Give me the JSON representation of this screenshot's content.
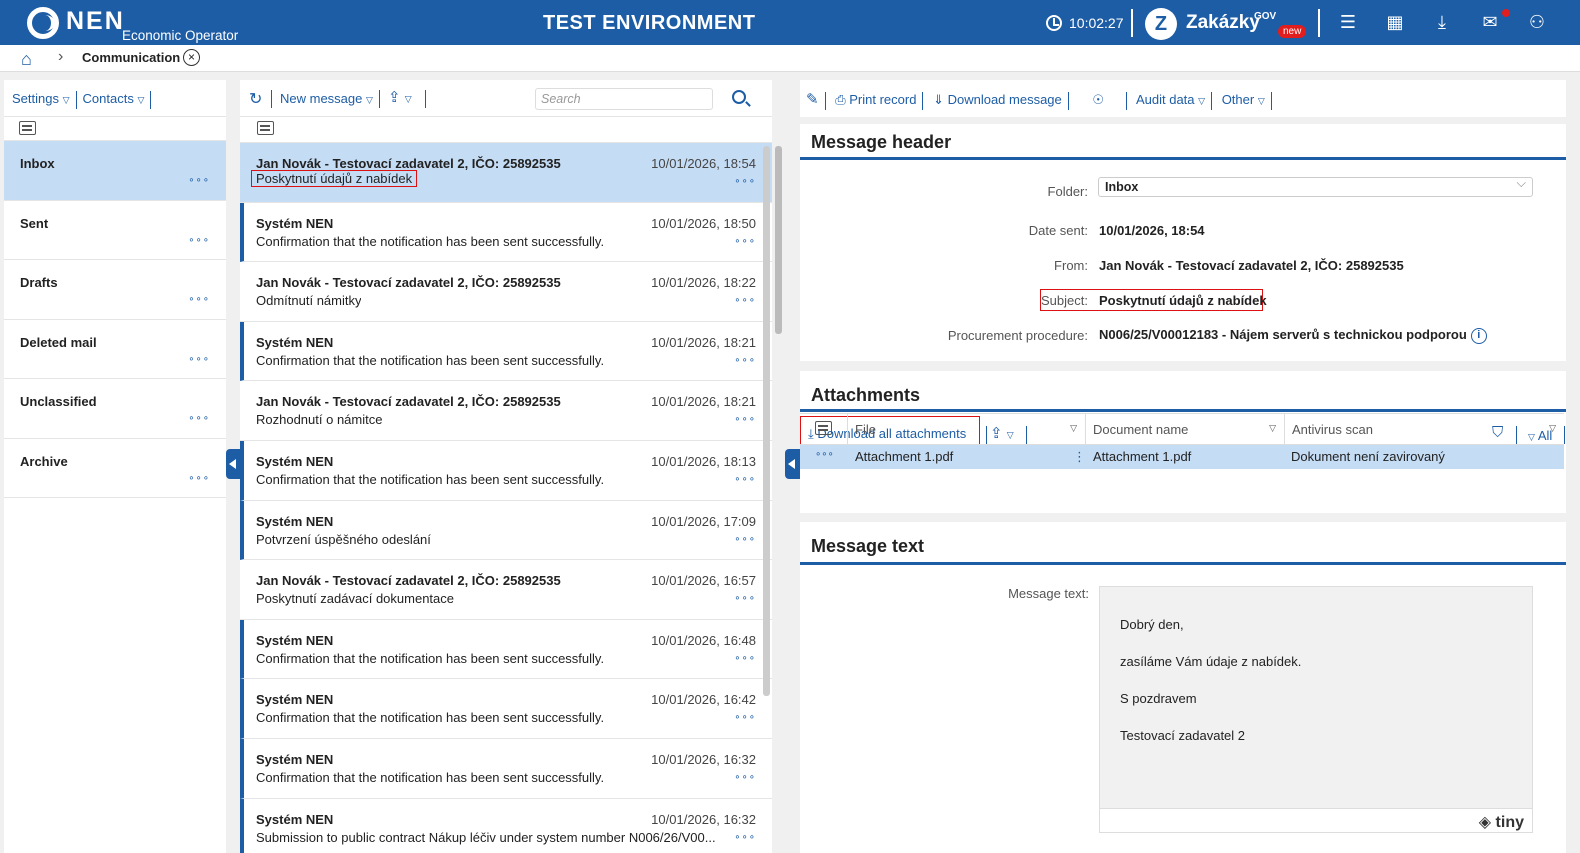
{
  "header": {
    "logo": "NEN",
    "logo_sub": "Economic Operator",
    "environment": "TEST ENVIRONMENT",
    "time": "10:02:27",
    "zakazky": "Zakázky",
    "zakazky_sup": "GOV",
    "zakazky_badge": "new",
    "colors": {
      "primary": "#1d5da6",
      "badge": "#e11d1d"
    }
  },
  "breadcrumb": {
    "title": "Communication"
  },
  "folders": {
    "toolbar": {
      "settings": "Settings",
      "contacts": "Contacts"
    },
    "items": [
      "Inbox",
      "Sent",
      "Drafts",
      "Deleted mail",
      "Unclassified",
      "Archive"
    ],
    "active_index": 0
  },
  "messages": {
    "toolbar": {
      "new_message": "New message",
      "search_placeholder": "Search"
    },
    "items": [
      {
        "from": "Jan Novák - Testovací zadavatel 2, IČO: 25892535",
        "subject": "Poskytnutí údajů z nabídek",
        "date": "10/01/2026, 18:54"
      },
      {
        "from": "Systém NEN",
        "subject": "Confirmation that the notification has been sent successfully.",
        "date": "10/01/2026, 18:50"
      },
      {
        "from": "Jan Novák - Testovací zadavatel 2, IČO: 25892535",
        "subject": "Odmítnutí námitky",
        "date": "10/01/2026, 18:22"
      },
      {
        "from": "Systém NEN",
        "subject": "Confirmation that the notification has been sent successfully.",
        "date": "10/01/2026, 18:21"
      },
      {
        "from": "Jan Novák - Testovací zadavatel 2, IČO: 25892535",
        "subject": "Rozhodnutí o námitce",
        "date": "10/01/2026, 18:21"
      },
      {
        "from": "Systém NEN",
        "subject": "Confirmation that the notification has been sent successfully.",
        "date": "10/01/2026, 18:13"
      },
      {
        "from": "Systém NEN",
        "subject": "Potvrzení úspěšného odeslání",
        "date": "10/01/2026, 17:09"
      },
      {
        "from": "Jan Novák - Testovací zadavatel 2, IČO: 25892535",
        "subject": "Poskytnutí zadávací dokumentace",
        "date": "10/01/2026, 16:57"
      },
      {
        "from": "Systém NEN",
        "subject": "Confirmation that the notification has been sent successfully.",
        "date": "10/01/2026, 16:48"
      },
      {
        "from": "Systém NEN",
        "subject": "Confirmation that the notification has been sent successfully.",
        "date": "10/01/2026, 16:42"
      },
      {
        "from": "Systém NEN",
        "subject": "Confirmation that the notification has been sent successfully.",
        "date": "10/01/2026, 16:32"
      },
      {
        "from": "Systém NEN",
        "subject": "Submission to public contract Nákup léčiv under system number N006/26/V00...",
        "date": "10/01/2026, 16:32"
      }
    ]
  },
  "detail": {
    "toolbar": {
      "print": "Print record",
      "download": "Download message",
      "audit": "Audit data",
      "other": "Other"
    },
    "header_title": "Message header",
    "fields": {
      "folder_label": "Folder:",
      "folder_value": "Inbox",
      "date_label": "Date sent:",
      "date_value": "10/01/2026, 18:54",
      "from_label": "From:",
      "from_value": "Jan Novák - Testovací zadavatel 2, IČO: 25892535",
      "subject_label": "Subject:",
      "subject_value": "Poskytnutí údajů z nabídek",
      "procedure_label": "Procurement procedure:",
      "procedure_value": "N006/25/V00012183 - Nájem serverů s technickou podporou"
    },
    "attachments": {
      "title": "Attachments",
      "download_all": "Download all attachments",
      "filter_all": "All",
      "columns": [
        "File",
        "Document name",
        "Antivirus scan"
      ],
      "rows": [
        {
          "file": "Attachment 1.pdf",
          "name": "Attachment 1.pdf",
          "scan": "Dokument není zavirovaný"
        }
      ]
    },
    "text_section": {
      "title": "Message text",
      "label": "Message text:",
      "lines": [
        "Dobrý den,",
        "zasíláme Vám údaje z nabídek.",
        "S pozdravem",
        "Testovací zadavatel 2"
      ],
      "editor_brand": "tiny"
    }
  }
}
